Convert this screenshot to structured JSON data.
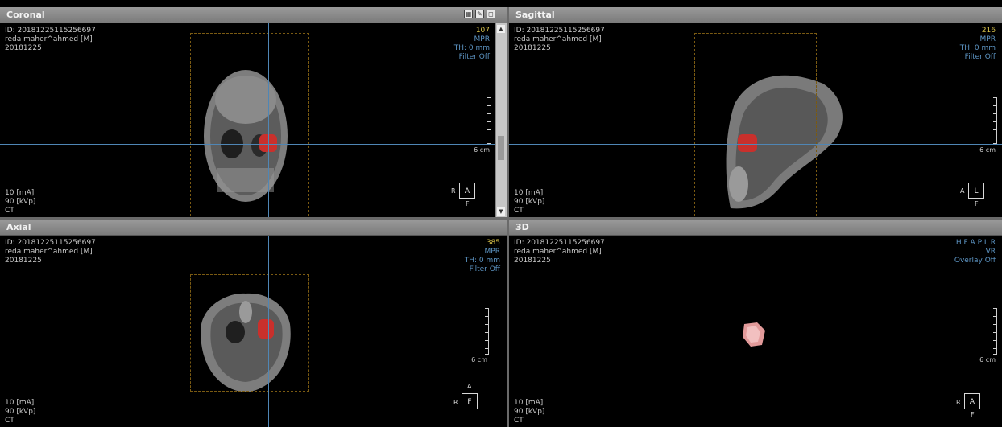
{
  "panes": {
    "coronal": {
      "title": "Coronal",
      "id_line": "ID: 20181225115256697",
      "patient": "reda maher^ahmed [M]",
      "date": "20181225",
      "slice": "107",
      "mode": "MPR",
      "thickness": "TH: 0 mm",
      "filter": "Filter Off",
      "ma": "10 [mA]",
      "kvp": "90 [kVp]",
      "modality": "CT",
      "scale_label": "6 cm",
      "orient_box": "A",
      "orient_left": "R",
      "orient_bottom": "F"
    },
    "sagittal": {
      "title": "Sagittal",
      "id_line": "ID: 20181225115256697",
      "patient": "reda maher^ahmed [M]",
      "date": "20181225",
      "slice": "216",
      "mode": "MPR",
      "thickness": "TH: 0 mm",
      "filter": "Filter Off",
      "ma": "10 [mA]",
      "kvp": "90 [kVp]",
      "modality": "CT",
      "scale_label": "6 cm",
      "orient_box": "L",
      "orient_left": "A",
      "orient_bottom": "F"
    },
    "axial": {
      "title": "Axial",
      "id_line": "ID: 20181225115256697",
      "patient": "reda maher^ahmed [M]",
      "date": "20181225",
      "slice": "385",
      "mode": "MPR",
      "thickness": "TH: 0 mm",
      "filter": "Filter Off",
      "ma": "10 [mA]",
      "kvp": "90 [kVp]",
      "modality": "CT",
      "scale_label": "6 cm",
      "orient_box": "F",
      "orient_left": "R",
      "orient_top": "A"
    },
    "view3d": {
      "title": "3D",
      "id_line": "ID: 20181225115256697",
      "patient": "reda maher^ahmed [M]",
      "date": "20181225",
      "orient_line": "H F A P L R",
      "render_mode": "VR",
      "overlay": "Overlay Off",
      "ma": "10 [mA]",
      "kvp": "90 [kVp]",
      "modality": "CT",
      "scale_label": "6 cm",
      "orient_box": "A",
      "orient_left": "R",
      "orient_bottom": "F"
    }
  },
  "colors": {
    "crosshair": "#4f86b5",
    "roi": "#c9302c",
    "slice_number": "#d9c34a",
    "overlay_text": "#5d95c4"
  }
}
